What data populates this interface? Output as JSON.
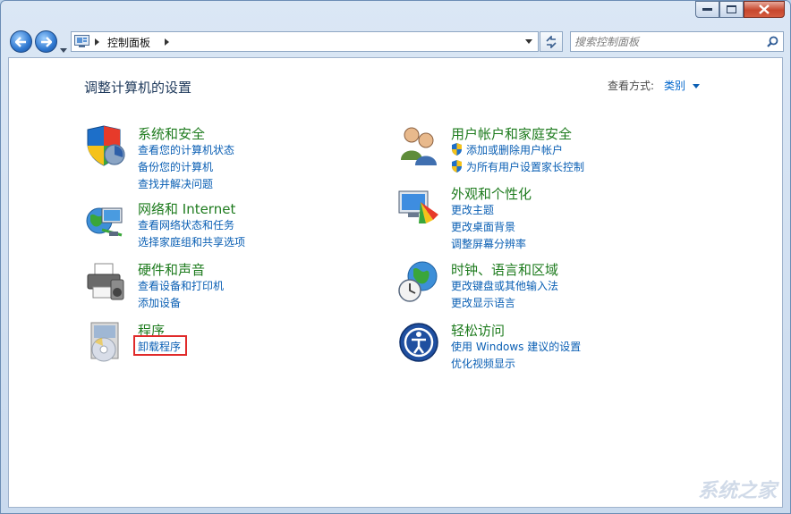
{
  "nav": {
    "breadcrumb": "控制面板",
    "search_placeholder": "搜索控制面板"
  },
  "header": {
    "title": "调整计算机的设置",
    "view_by_label": "查看方式:",
    "view_by_value": "类别"
  },
  "categories": [
    {
      "title": "系统和安全",
      "links": [
        "查看您的计算机状态",
        "备份您的计算机",
        "查找并解决问题"
      ]
    },
    {
      "title": "网络和 Internet",
      "links": [
        "查看网络状态和任务",
        "选择家庭组和共享选项"
      ]
    },
    {
      "title": "硬件和声音",
      "links": [
        "查看设备和打印机",
        "添加设备"
      ]
    },
    {
      "title": "程序",
      "links": [
        "卸载程序"
      ]
    },
    {
      "title": "用户帐户和家庭安全",
      "links": [
        "添加或删除用户帐户",
        "为所有用户设置家长控制"
      ]
    },
    {
      "title": "外观和个性化",
      "links": [
        "更改主题",
        "更改桌面背景",
        "调整屏幕分辨率"
      ]
    },
    {
      "title": "时钟、语言和区域",
      "links": [
        "更改键盘或其他输入法",
        "更改显示语言"
      ]
    },
    {
      "title": "轻松访问",
      "links": [
        "使用 Windows 建议的设置",
        "优化视频显示"
      ]
    }
  ],
  "watermark": "系统之家",
  "colors": {
    "category_title": "#1e7b1e",
    "link": "#0a5fb4",
    "highlight_box": "#e02a2a"
  }
}
